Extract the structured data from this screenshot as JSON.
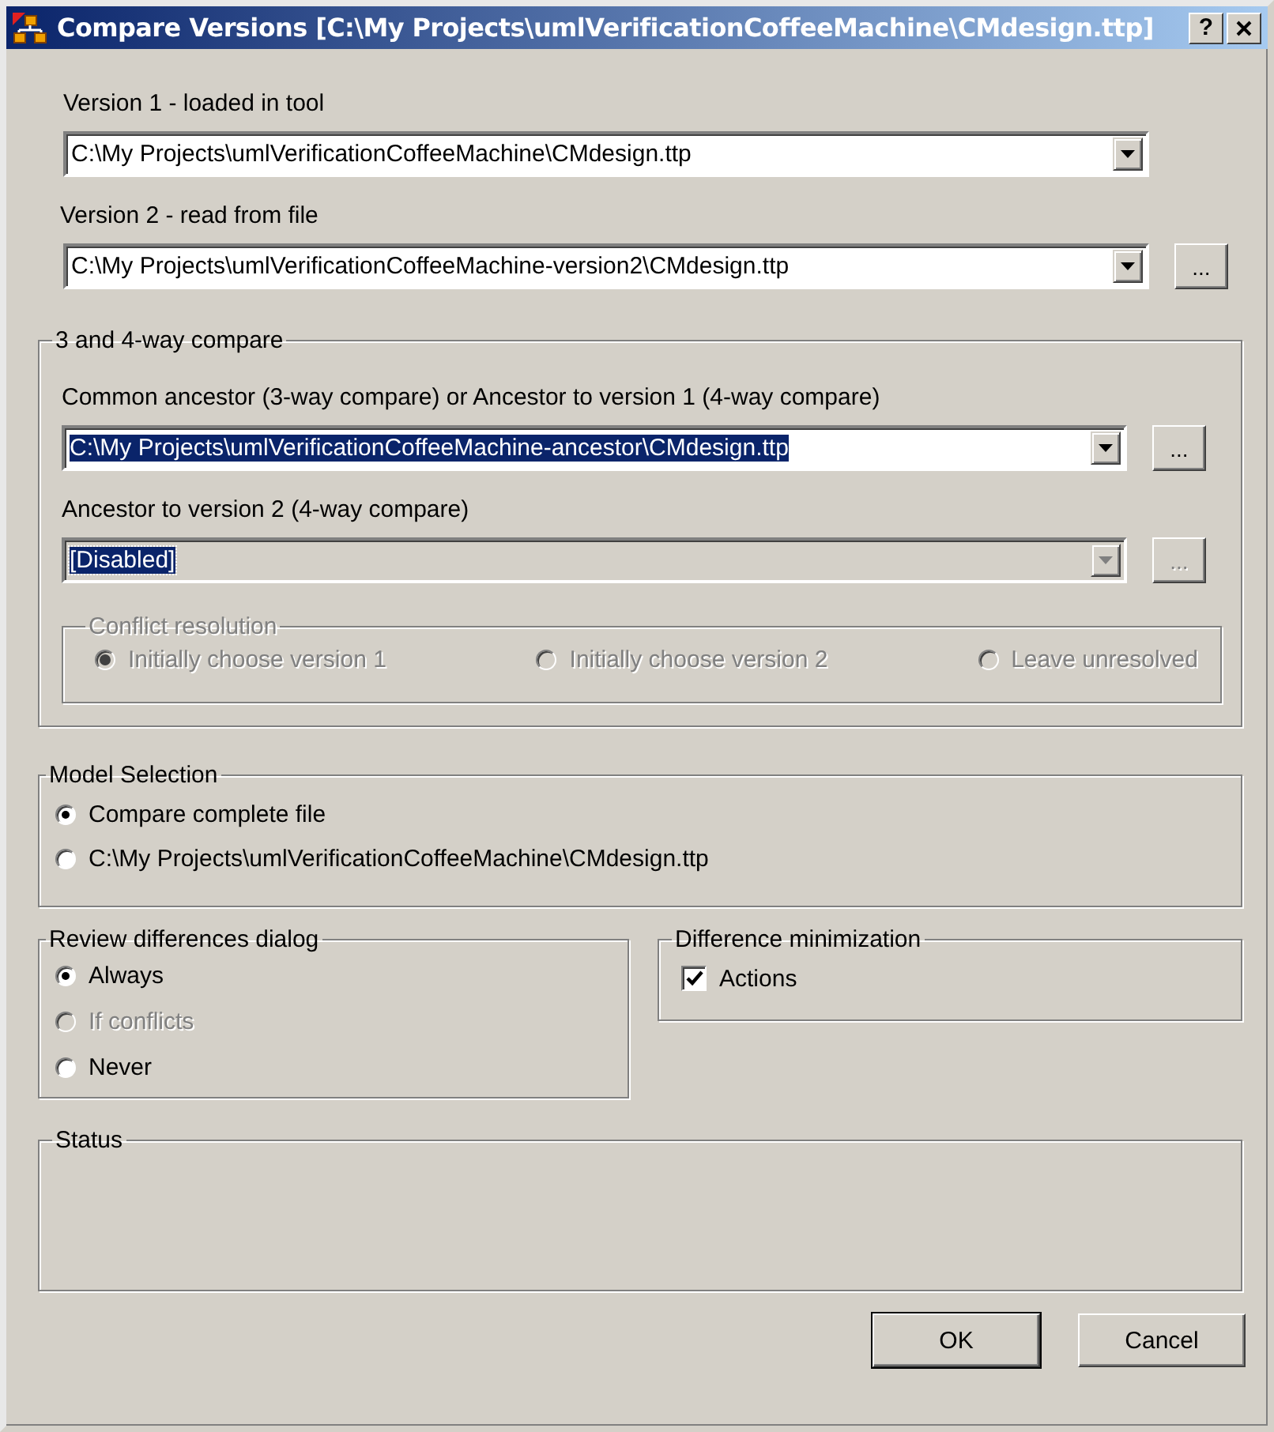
{
  "window": {
    "title": "Compare Versions [C:\\My Projects\\umlVerificationCoffeeMachine\\CMdesign.ttp]",
    "help": "?"
  },
  "version_1": {
    "label": "Version 1 - loaded in tool",
    "value": "C:\\My Projects\\umlVerificationCoffeeMachine\\CMdesign.ttp",
    "highlighted": false,
    "disabled": false
  },
  "version_2": {
    "label": "Version 2 - read from file",
    "value": "C:\\My Projects\\umlVerificationCoffeeMachine-version2\\CMdesign.ttp",
    "highlighted": false,
    "disabled": false,
    "browse": "..."
  },
  "compare_group": {
    "title": "3 and 4-way compare",
    "ancestor_1": {
      "label": "Common ancestor (3-way compare) or Ancestor to version 1 (4-way compare)",
      "value": "C:\\My Projects\\umlVerificationCoffeeMachine-ancestor\\CMdesign.ttp",
      "highlighted": true,
      "disabled": false,
      "browse": "..."
    },
    "ancestor_2": {
      "label": "Ancestor to version 2 (4-way compare)",
      "value": "[Disabled]",
      "highlighted": true,
      "disabled": true,
      "browse": "..."
    },
    "conflict_resolution": {
      "title": "Conflict resolution",
      "disabled": true,
      "options": [
        {
          "label": "Initially choose version 1",
          "selected": true
        },
        {
          "label": "Initially choose version 2",
          "selected": false
        },
        {
          "label": "Leave unresolved",
          "selected": false
        }
      ]
    }
  },
  "model_selection": {
    "title": "Model Selection",
    "options": [
      {
        "label": "Compare complete file",
        "selected": true
      },
      {
        "label": "C:\\My Projects\\umlVerificationCoffeeMachine\\CMdesign.ttp",
        "selected": false
      }
    ]
  },
  "review_dialog": {
    "title": "Review differences dialog",
    "options": [
      {
        "label": "Always",
        "selected": true,
        "disabled": false
      },
      {
        "label": "If conflicts",
        "selected": false,
        "disabled": true
      },
      {
        "label": "Never",
        "selected": false,
        "disabled": false
      }
    ]
  },
  "difference_minimization": {
    "title": "Difference minimization",
    "options": [
      {
        "label": "Actions",
        "checked": true
      }
    ]
  },
  "status": {
    "title": "Status"
  },
  "buttons": [
    {
      "label": "OK",
      "default": true
    },
    {
      "label": "Cancel",
      "default": false
    }
  ]
}
